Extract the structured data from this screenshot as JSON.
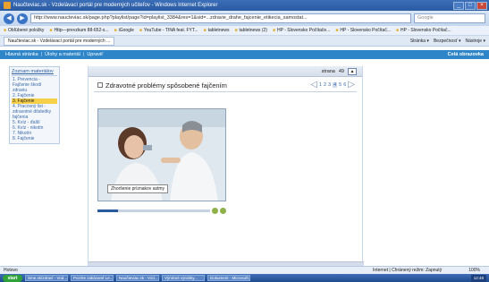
{
  "window": {
    "title": "Naučteviac.sk - Vzdelávací portál pre moderných učiteľov - Windows Internet Explorer",
    "controls": [
      "_",
      "□",
      "×"
    ]
  },
  "addressbar": {
    "url": "http://www.naucteviac.sk/page.php?playlist/page?id=playlist_3384&res=1&sid=...zdravie_drahe_fajcenie_etikecia_samostat...",
    "search_placeholder": "Google"
  },
  "favorites": {
    "items": [
      "Obľúbené položky",
      "Http—prevzkum 88-652-s...",
      "iGoogle",
      "YouTube - TINA feat. FYT...",
      "tabletnews",
      "tabletnews (2)",
      "HP - Slovensko Počítače...",
      "HP - Slovensko Počítač...",
      "HP - Slovensko Počítač..."
    ]
  },
  "tabs": {
    "active": "Naučteviac.sk - Vzdelávací portál pre moderných ...",
    "tools": [
      "Stránka ▾",
      "Bezpečnosť ▾",
      "Nástroje ▾"
    ]
  },
  "sitenav": {
    "links": [
      "Hlavná stránka",
      "Úlohy a materiál",
      "Upraviť"
    ],
    "right": "Celá obrazovka"
  },
  "sidebar": {
    "heading": "Zoznam materiálov",
    "items": [
      {
        "label": "1. Prevencia - Fajčenie škodí zdraviu",
        "sub": false,
        "active": false
      },
      {
        "label": "2. Fajčenie",
        "sub": false,
        "active": false
      },
      {
        "label": "3. Fajčenie",
        "sub": false,
        "active": true
      },
      {
        "label": "4. Pracovný list - zdravotné dôsledky fajčenia",
        "sub": false,
        "active": false
      },
      {
        "label": "5. Kvíz - ďalší",
        "sub": false,
        "active": false
      },
      {
        "label": "6. Kvíz - nikotín",
        "sub": false,
        "active": false
      },
      {
        "label": "7. Nikotín",
        "sub": false,
        "active": false
      },
      {
        "label": "8. Fajčenie",
        "sub": false,
        "active": false
      }
    ]
  },
  "main": {
    "page_label": "strana",
    "page_number": "49",
    "topic_title": "Zdravotné problémy spôsobené fajčením",
    "pager": [
      "1",
      "2",
      "3",
      "4",
      "5",
      "6"
    ],
    "pager_current": "4",
    "caption": "Zhoršenie príznakov astmy",
    "video_progress": 0.18
  },
  "statusbar": {
    "left": "Hotovo",
    "zone": "Internet | Chránený režim: Zapnutý",
    "zoom": "100%"
  },
  "taskbar": {
    "start": "start",
    "items": [
      "Sme.sk/zdraví - Vod...",
      "Pozrite zakázané Le...",
      "Naučteviac.sk - Vzd...",
      "Výrobné výrobky...",
      "Dokument - Microsoft..."
    ],
    "tray": "12:48"
  },
  "colors": {
    "accent": "#2e86c8",
    "active_item": "#f6d049"
  }
}
